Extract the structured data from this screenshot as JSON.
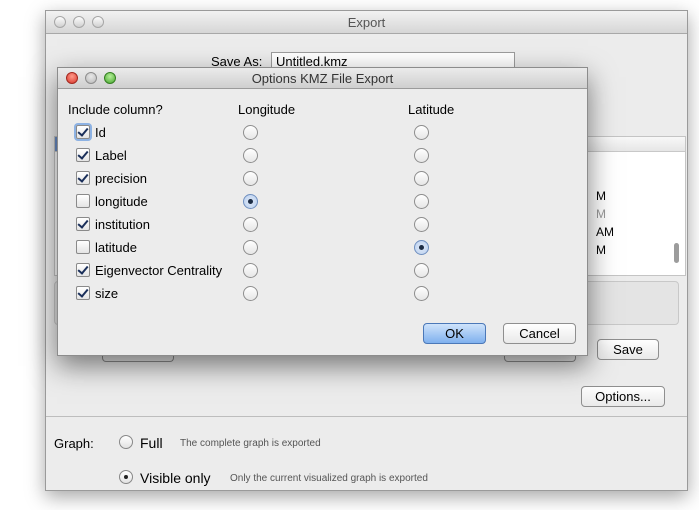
{
  "export_window": {
    "title": "Export",
    "save_as_label": "Save As:",
    "save_as_value": "Untitled.kmz",
    "list_fragments": [
      "M",
      "M",
      "AM",
      "M"
    ],
    "save_button": "Save",
    "options_button": "Options...",
    "graph": {
      "label": "Graph:",
      "options": [
        {
          "label": "Full",
          "description": "The complete graph is exported",
          "selected": false
        },
        {
          "label": "Visible only",
          "description": "Only the current visualized graph is exported",
          "selected": true
        }
      ]
    }
  },
  "dialog": {
    "title": "Options KMZ File Export",
    "headers": {
      "include": "Include column?",
      "longitude": "Longitude",
      "latitude": "Latitude"
    },
    "rows": [
      {
        "label": "Id",
        "include": true,
        "longitude": false,
        "latitude": false
      },
      {
        "label": "Label",
        "include": true,
        "longitude": false,
        "latitude": false
      },
      {
        "label": "precision",
        "include": true,
        "longitude": false,
        "latitude": false
      },
      {
        "label": "longitude",
        "include": false,
        "longitude": true,
        "latitude": false
      },
      {
        "label": "institution",
        "include": true,
        "longitude": false,
        "latitude": false
      },
      {
        "label": "latitude",
        "include": false,
        "longitude": false,
        "latitude": true
      },
      {
        "label": "Eigenvector Centrality",
        "include": true,
        "longitude": false,
        "latitude": false
      },
      {
        "label": "size",
        "include": true,
        "longitude": false,
        "latitude": false
      }
    ],
    "ok_button": "OK",
    "cancel_button": "Cancel"
  }
}
